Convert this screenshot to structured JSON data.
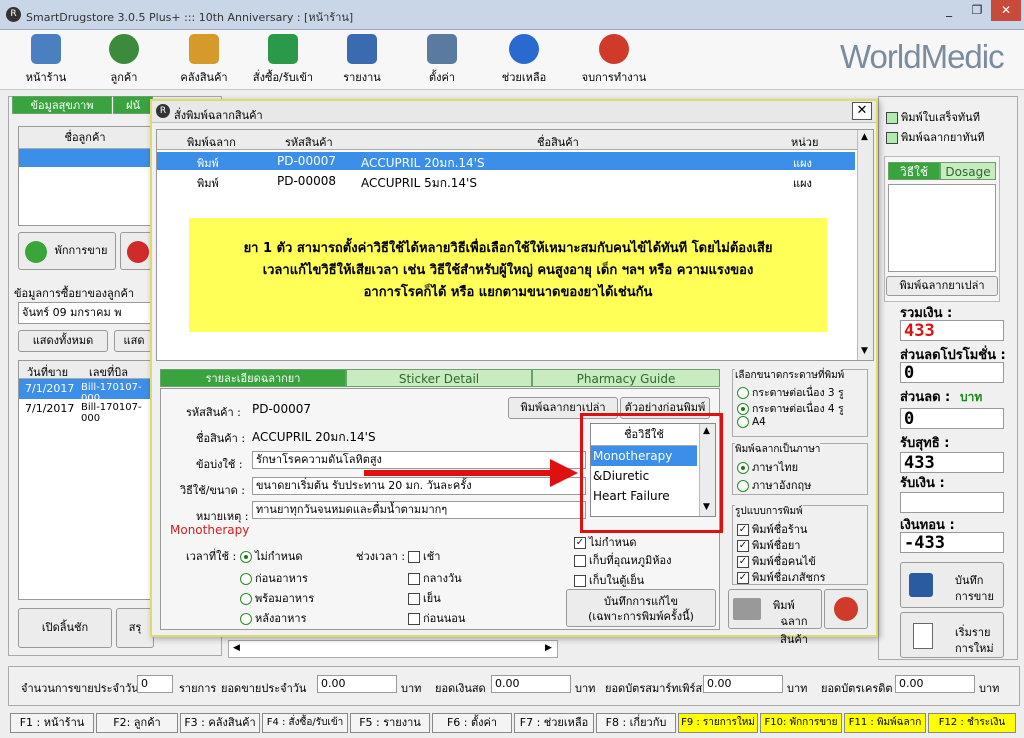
{
  "app": {
    "title": "SmartDrugstore 3.0.5 Plus+ ::: 10th Anniversary : [หน้าร้าน]",
    "brand": "WorldMedic",
    "logo_letter": "R"
  },
  "window_controls": {
    "minimize": "_",
    "restore": "❐",
    "close": "✕"
  },
  "toolbar": [
    {
      "label": "หน้าร้าน",
      "icon": "monitor-icon",
      "color": "#4a7fc0"
    },
    {
      "label": "ลูกค้า",
      "icon": "users-icon",
      "color": "#3c8a3c"
    },
    {
      "label": "คลังสินค้า",
      "icon": "warehouse-icon",
      "color": "#d69a2a"
    },
    {
      "label": "สั่งซื้อ/รับเข้า",
      "icon": "order-icon",
      "color": "#2a9a4a"
    },
    {
      "label": "รายงาน",
      "icon": "report-chart-icon",
      "color": "#3a6ab0"
    },
    {
      "label": "ตั้งค่า",
      "icon": "tools-icon",
      "color": "#5a7aa0"
    },
    {
      "label": "ช่วยเหลือ",
      "icon": "help-icon",
      "color": "#2a6ad0"
    },
    {
      "label": "จบการทำงาน",
      "icon": "power-icon",
      "color": "#d03a2a"
    }
  ],
  "left": {
    "tabs": [
      "ข้อมูลสุขภาพ",
      "ฝนั"
    ],
    "customer_col": "ชื่อลูกค้า",
    "pause_button": "พักการขาย",
    "history_label": "ข้อมูลการซื้อยาของลูกค้า",
    "date_value": "จันทร์   09   มกราคม  พ",
    "show_all": "แสดงทั้งหมด",
    "show2": "แสด",
    "cols": [
      "วันที่ขาย",
      "เลขที่บิล"
    ],
    "rows": [
      [
        "7/1/2017",
        "Bill-170107-000"
      ],
      [
        "7/1/2017",
        "Bill-170107-000"
      ]
    ],
    "open_drawer": "เปิดลิ้นชัก",
    "summary_btn": "สรุ"
  },
  "dialog": {
    "title": "สั่งพิมพ์ฉลากสินค้า",
    "cols": [
      "พิมพ์ฉลาก",
      "รหัสสินค้า",
      "ชื่อสินค้า",
      "หน่วย"
    ],
    "rows": [
      {
        "print": "พิมพ์",
        "code": "PD-00007",
        "name": "ACCUPRIL 20มก.14'S",
        "unit": "แผง"
      },
      {
        "print": "พิมพ์",
        "code": "PD-00008",
        "name": "ACCUPRIL 5มก.14'S",
        "unit": "แผง"
      }
    ],
    "banner": [
      "ยา 1 ตัว สามารถตั้งค่าวิธีใช้ได้หลายวิธีเพื่อเลือกใช้ให้เหมาะสมกับคนไข้ได้ทันที โดยไม่ต้องเสีย",
      "เวลาแก้ไขวิธีให้เสียเวลา เช่น วิธีใช้สำหรับผู้ใหญ่  คนสูงอายุ  เด็ก ฯลฯ หรือ ความแรงของ",
      "อาการโรคก็ได้ หรือ แยกตามขนาดของยาได้เช่นกัน"
    ],
    "tabs": [
      "รายละเอียดฉลากยา",
      "Sticker Detail",
      "Pharmacy Guide"
    ],
    "code_label": "รหัสสินค้า :",
    "code_value": "PD-00007",
    "name_label": "ชื่อสินค้า :",
    "name_value": "ACCUPRIL 20มก.14'S",
    "print_blank": "พิมพ์ฉลากยาเปล่า",
    "preview": "ตัวอย่างก่อนพิมพ์",
    "indication_label": "ข้อบ่งใช้ :",
    "indication_value": "รักษาโรคความดันโลหิตสูง",
    "usage_label": "วิธีใช้/ขนาด :",
    "usage_value": "ขนาดยาเริ่มต้น รับประทาน 20 มก. วันละครั้ง",
    "note_label": "หมายเหตุ :",
    "note_value": "ทานยาทุกวันจนหมดและดื่มน้ำตามมากๆ",
    "selected_method": "Monotherapy",
    "time_label": "เวลาที่ใช้ :",
    "time_options": [
      "ไม่กำหนด",
      "ก่อนอาหาร",
      "พร้อมอาหาร",
      "หลังอาหาร"
    ],
    "period_label": "ช่วงเวลา :",
    "period_options": [
      "เช้า",
      "กลางวัน",
      "เย็น",
      "ก่อนนอน"
    ],
    "method_list_title": "ชื่อวิธีใช้",
    "methods": [
      "Monotherapy",
      "&Diuretic",
      "Heart Failure"
    ],
    "storage": [
      "ไม่กำหนด",
      "เก็บที่อุณหภูมิห้อง",
      "เก็บในตู้เย็น"
    ],
    "save_edit": [
      "บันทึกการแก้ไข",
      "(เฉพาะการพิมพ์ครั้งนี้)"
    ],
    "paper_group": "เลือกขนาดกระดาษที่พิมพ์",
    "paper_options": [
      "กระดาษต่อเนื่อง 3 รู",
      "กระดาษต่อเนื่อง 4 รู",
      "A4"
    ],
    "lang_group": "พิมพ์ฉลากเป็นภาษา",
    "lang_options": [
      "ภาษาไทย",
      "ภาษาอังกฤษ"
    ],
    "format_group": "รูปแบบการพิมพ์",
    "format_options": [
      "พิมพ์ชื่อร้าน",
      "พิมพ์ชื่อยา",
      "พิมพ์ชื่อคนไข้",
      "พิมพ์ชื่อเภสัชกร"
    ],
    "print_button": [
      "พิมพ์",
      "ฉลากสินค้า"
    ]
  },
  "right": {
    "print_receipt": "พิมพ์ใบเสร็จทันที",
    "print_label": "พิมพ์ฉลากยาทันที",
    "tabs": [
      "วิธีใช้",
      "Dosage"
    ],
    "print_blank": "พิมพ์ฉลากยาเปล่า",
    "total_label": "รวมเงิน :",
    "total_value": "433",
    "promo_label": "ส่วนลดโปรโมชั่น :",
    "promo_value": "0",
    "discount_label": "ส่วนลด :",
    "discount_unit": "บาท",
    "discount_value": "0",
    "net_label": "รับสุทธิ :",
    "net_value": "433",
    "received_label": "รับเงิน :",
    "received_value": "",
    "change_label": "เงินทอน :",
    "change_value": "-433",
    "save_sale": [
      "บันทึก",
      "การขาย"
    ],
    "new_list": [
      "เริ่มราย",
      "การใหม่"
    ]
  },
  "status": {
    "daily_count_label": "จำนวนการขายประจำวัน",
    "daily_count": "0",
    "items_label": "รายการ",
    "daily_sales_label": "ยอดขายประจำวัน",
    "daily_sales": "0.00",
    "baht1": "บาท",
    "cash_label": "ยอดเงินสด",
    "cash": "0.00",
    "baht2": "บาท",
    "member_label": "ยอดบัตรสมาร์ทเพิร์ส",
    "member": "0.00",
    "baht3": "บาท",
    "credit_label": "ยอดบัตรเครดิต",
    "credit": "0.00",
    "baht4": "บาท"
  },
  "fkeys": [
    "F1 : หน้าร้าน",
    "F2: ลูกค้า",
    "F3 : คลังสินค้า",
    "F4 : สั่งซื้อ/รับเข้า",
    "F5 : รายงาน",
    "F6 : ตั้งค่า",
    "F7 : ช่วยเหลือ",
    "F8 : เกี่ยวกับ",
    "F9 : รายการใหม่",
    "F10: พักการขาย",
    "F11 : พิมพ์ฉลาก",
    "F12 : ชำระเงิน"
  ]
}
